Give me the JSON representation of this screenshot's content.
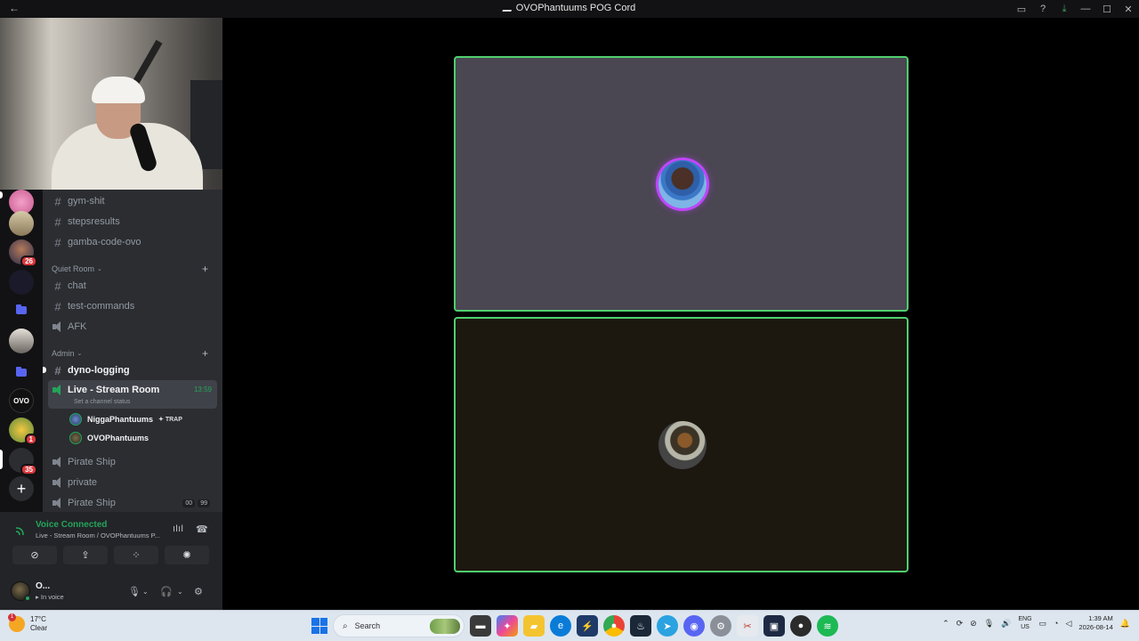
{
  "window": {
    "title": "OVOPhantuums POG Cord",
    "back_icon": "←",
    "controls": [
      "inbox-icon",
      "help-icon",
      "download-icon",
      "minimize-icon",
      "maximize-icon",
      "close-icon"
    ]
  },
  "servers": {
    "badges": {
      "s1": "26",
      "s2": "1",
      "s3": "35"
    }
  },
  "channels": {
    "items": [
      {
        "label": "gym-shit",
        "type": "text"
      },
      {
        "label": "stepsresults",
        "type": "text"
      },
      {
        "label": "gamba-code-ovo",
        "type": "text"
      }
    ],
    "cat_quiet": "Quiet Room",
    "quiet_items": [
      {
        "label": "chat",
        "type": "text"
      },
      {
        "label": "test-commands",
        "type": "text"
      },
      {
        "label": "AFK",
        "type": "voice"
      }
    ],
    "cat_admin": "Admin",
    "admin_items": {
      "dyno": "dyno-logging",
      "live": "Live - Stream Room",
      "live_timer": "13:59",
      "live_status": "Set a channel status",
      "pirate1": "Pirate Ship",
      "private": "private",
      "pirate2": "Pirate Ship",
      "pirate2_counts": [
        "00",
        "99"
      ]
    },
    "members": [
      {
        "name": "NiggaPhantuums",
        "tag": "TRAP"
      },
      {
        "name": "OVOPhantuums",
        "tag": ""
      }
    ]
  },
  "voice": {
    "title": "Voice Connected",
    "subtitle": "Live - Stream Room / OVOPhantuums P...",
    "user_name": "O...",
    "user_status": "In voice"
  },
  "taskbar": {
    "temp": "17°C",
    "weather": "Clear",
    "weather_badge": "1",
    "search_placeholder": "Search",
    "lang_top": "ENG",
    "lang_bottom": "US",
    "time": "1:39 AM",
    "date": "2026-08-14"
  },
  "colors": {
    "speaking_border": "#4fcf6e",
    "voice_green": "#23a55a",
    "tile1_bg": "#4a4652",
    "tile2_bg": "#1c1810",
    "nitro_ring": "#c046ff"
  }
}
